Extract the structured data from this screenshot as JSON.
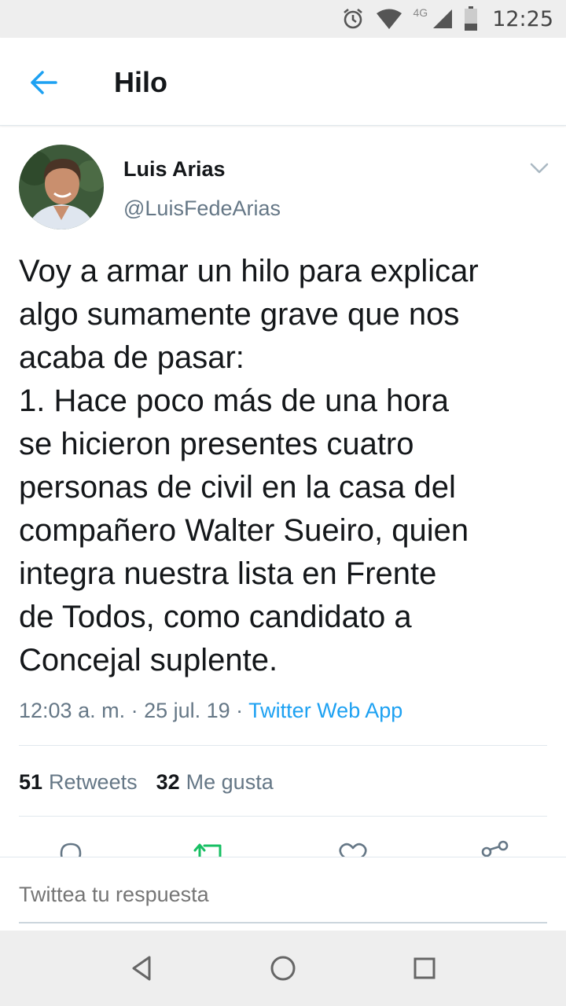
{
  "status_bar": {
    "network": "4G",
    "time": "12:25",
    "icons": [
      "alarm-icon",
      "wifi-icon",
      "signal-icon",
      "battery-icon"
    ]
  },
  "header": {
    "title": "Hilo",
    "back_icon": "arrow-left-icon"
  },
  "tweet": {
    "author_name": "Luis Arias",
    "author_handle": "@LuisFedeArias",
    "text": "Voy a armar un hilo para explicar\nalgo sumamente grave que nos\nacaba de pasar:\n1. Hace poco más de una hora\nse hicieron presentes cuatro\npersonas de civil en la casa del\ncompañero Walter Sueiro, quien\nintegra nuestra lista en Frente\nde Todos, como candidato a\nConcejal suplente.",
    "timestamp": "12:03 a. m. · 25 jul. 19 · ",
    "source": "Twitter Web App",
    "retweets_count": "51",
    "retweets_label": "Retweets",
    "likes_count": "32",
    "likes_label": "Me gusta"
  },
  "actions": [
    "reply-icon",
    "retweet-icon",
    "like-icon",
    "share-icon"
  ],
  "reply": {
    "placeholder": "Twittea tu respuesta"
  },
  "colors": {
    "accent": "#1da1f2",
    "retweet_active": "#17bf63",
    "text_secondary": "#657786"
  },
  "nav_bar": [
    "back-triangle-icon",
    "home-circle-icon",
    "recents-square-icon"
  ]
}
